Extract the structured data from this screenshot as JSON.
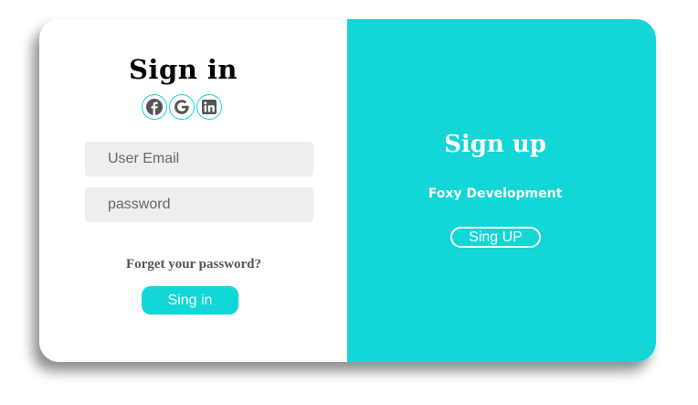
{
  "signin": {
    "title": "Sign in",
    "social_icons": [
      "facebook-icon",
      "google-icon",
      "linkedin-icon"
    ],
    "email_placeholder": "User Email",
    "password_placeholder": "password",
    "forgot_link": "Forget your password?",
    "button_label": "Sing in"
  },
  "signup": {
    "title": "Sign up",
    "subtitle": "Foxy Development",
    "button_label": "Sing UP"
  },
  "colors": {
    "accent": "#13d6d6",
    "icon": "#555555",
    "field_bg": "#eeeeee"
  }
}
